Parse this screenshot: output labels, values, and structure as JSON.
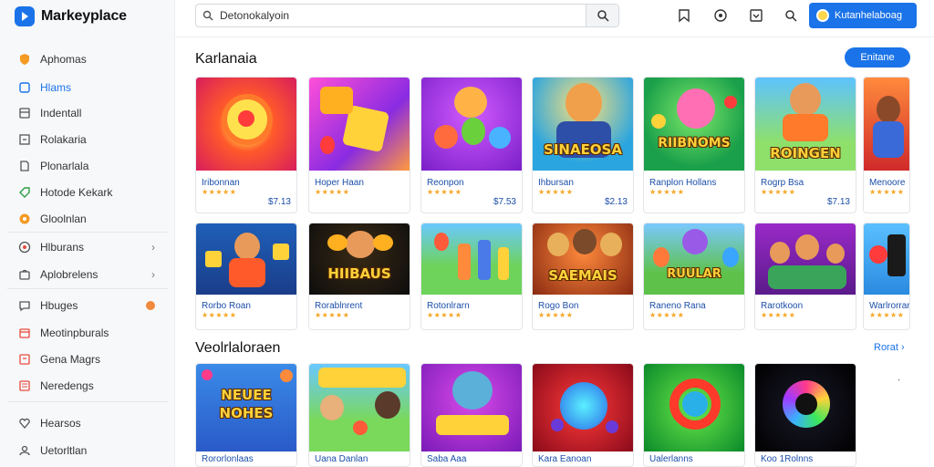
{
  "brand": {
    "name": "Markeyplace"
  },
  "sidebar": {
    "items": [
      {
        "label": "Aphomas",
        "icon": "shield-icon"
      },
      {
        "label": "Hlams",
        "icon": "home-icon",
        "active": true
      },
      {
        "label": "Indentall",
        "icon": "box-icon"
      },
      {
        "label": "Rolakaria",
        "icon": "grid-icon"
      },
      {
        "label": "Plonarlala",
        "icon": "document-icon"
      },
      {
        "label": "Hotode Kekark",
        "icon": "tag-icon"
      },
      {
        "label": "Gloolnlan",
        "icon": "disc-icon"
      },
      {
        "label": "Hlburans",
        "icon": "globe-icon",
        "chevron": "›"
      },
      {
        "label": "Aplobrelens",
        "icon": "bag-icon",
        "chevron": "›"
      },
      {
        "label": "Hbuges",
        "icon": "chat-icon",
        "dot": true
      },
      {
        "label": "Meotinpburals",
        "icon": "calendar-icon"
      },
      {
        "label": "Gena Magrs",
        "icon": "cart-icon"
      },
      {
        "label": "Neredengs",
        "icon": "list-icon"
      },
      {
        "label": "Hearsos",
        "icon": "heart-icon"
      },
      {
        "label": "Uetorltlan",
        "icon": "person-icon"
      }
    ]
  },
  "header": {
    "search_value": "Detonokalyoin",
    "account_label": "Kutanhelaboag"
  },
  "section1": {
    "title": "Karlanaia",
    "button_label": "Enitane",
    "row1": [
      {
        "name": "Iribonnan",
        "stars": "★★★★★",
        "price": "$7.13"
      },
      {
        "name": "Hoper Haan",
        "stars": "★★★★★",
        "price": ""
      },
      {
        "name": "Reonpon",
        "stars": "★★★★★",
        "price": "$7.53"
      },
      {
        "name": "Ihbursan",
        "stars": "★★★★★",
        "price": "$2.13"
      },
      {
        "name": "Ranplon Hollans",
        "stars": "★★★★★",
        "price": ""
      },
      {
        "name": "Rogrp Bsa",
        "stars": "★★★★★",
        "price": "$7.13"
      },
      {
        "name": "Menoore",
        "stars": "★★★★★",
        "price": ""
      }
    ],
    "row2": [
      {
        "name": "Rorbo Roan",
        "stars": "★★★★★"
      },
      {
        "name": "Rorablnrent",
        "stars": "★★★★★"
      },
      {
        "name": "Rotonlrarn",
        "stars": "★★★★★"
      },
      {
        "name": "Rogo Bon",
        "stars": "★★★★★"
      },
      {
        "name": "Raneno Rana",
        "stars": "★★★★★"
      },
      {
        "name": "Rarotkoon",
        "stars": "★★★★★"
      },
      {
        "name": "Warlrorrar",
        "stars": "★★★★★"
      }
    ],
    "thumb_texts_row1": [
      "",
      "",
      "",
      "SINAEOSA",
      "RIIBNOMS",
      "ROINGEN",
      ""
    ],
    "thumb_texts_row2": [
      "",
      "HIIBAUS",
      "",
      "SAEMAIS",
      "RUULAR",
      "",
      ""
    ]
  },
  "section2": {
    "title": "Veolrlaloraen",
    "see_label": "Rorat",
    "row3": [
      {
        "name": "Rororlonlaas"
      },
      {
        "name": "Uana Danlan"
      },
      {
        "name": "Saba Aaa"
      },
      {
        "name": "Kara Eanoan"
      },
      {
        "name": "Ualerlanns"
      },
      {
        "name": "Koo 1Rolnns"
      }
    ],
    "thumb_texts_row3": [
      "NEUEE NOHES",
      "",
      "",
      "",
      "",
      ""
    ]
  },
  "colors": {
    "accent": "#1a73e8",
    "link": "#1b4ea8",
    "star": "#f5a623",
    "dot": "#f08a3c"
  }
}
